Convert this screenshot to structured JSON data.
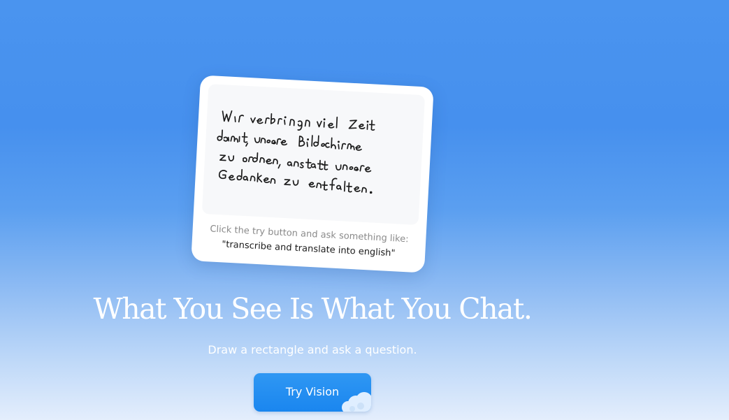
{
  "card": {
    "caption_line1": "Click the try button and ask something like:",
    "caption_line2": "\"transcribe and translate into english\""
  },
  "hero": {
    "headline": "What You See Is What You Chat.",
    "subline": "Draw a rectangle and ask a question."
  },
  "cta": {
    "label": "Try Vision"
  },
  "colors": {
    "background_top": "#4690ee",
    "background_bottom": "#e4eefc",
    "button": "#1a86ef",
    "card": "#ffffff"
  },
  "icons": {
    "button_decoration": "cloud-icon"
  }
}
